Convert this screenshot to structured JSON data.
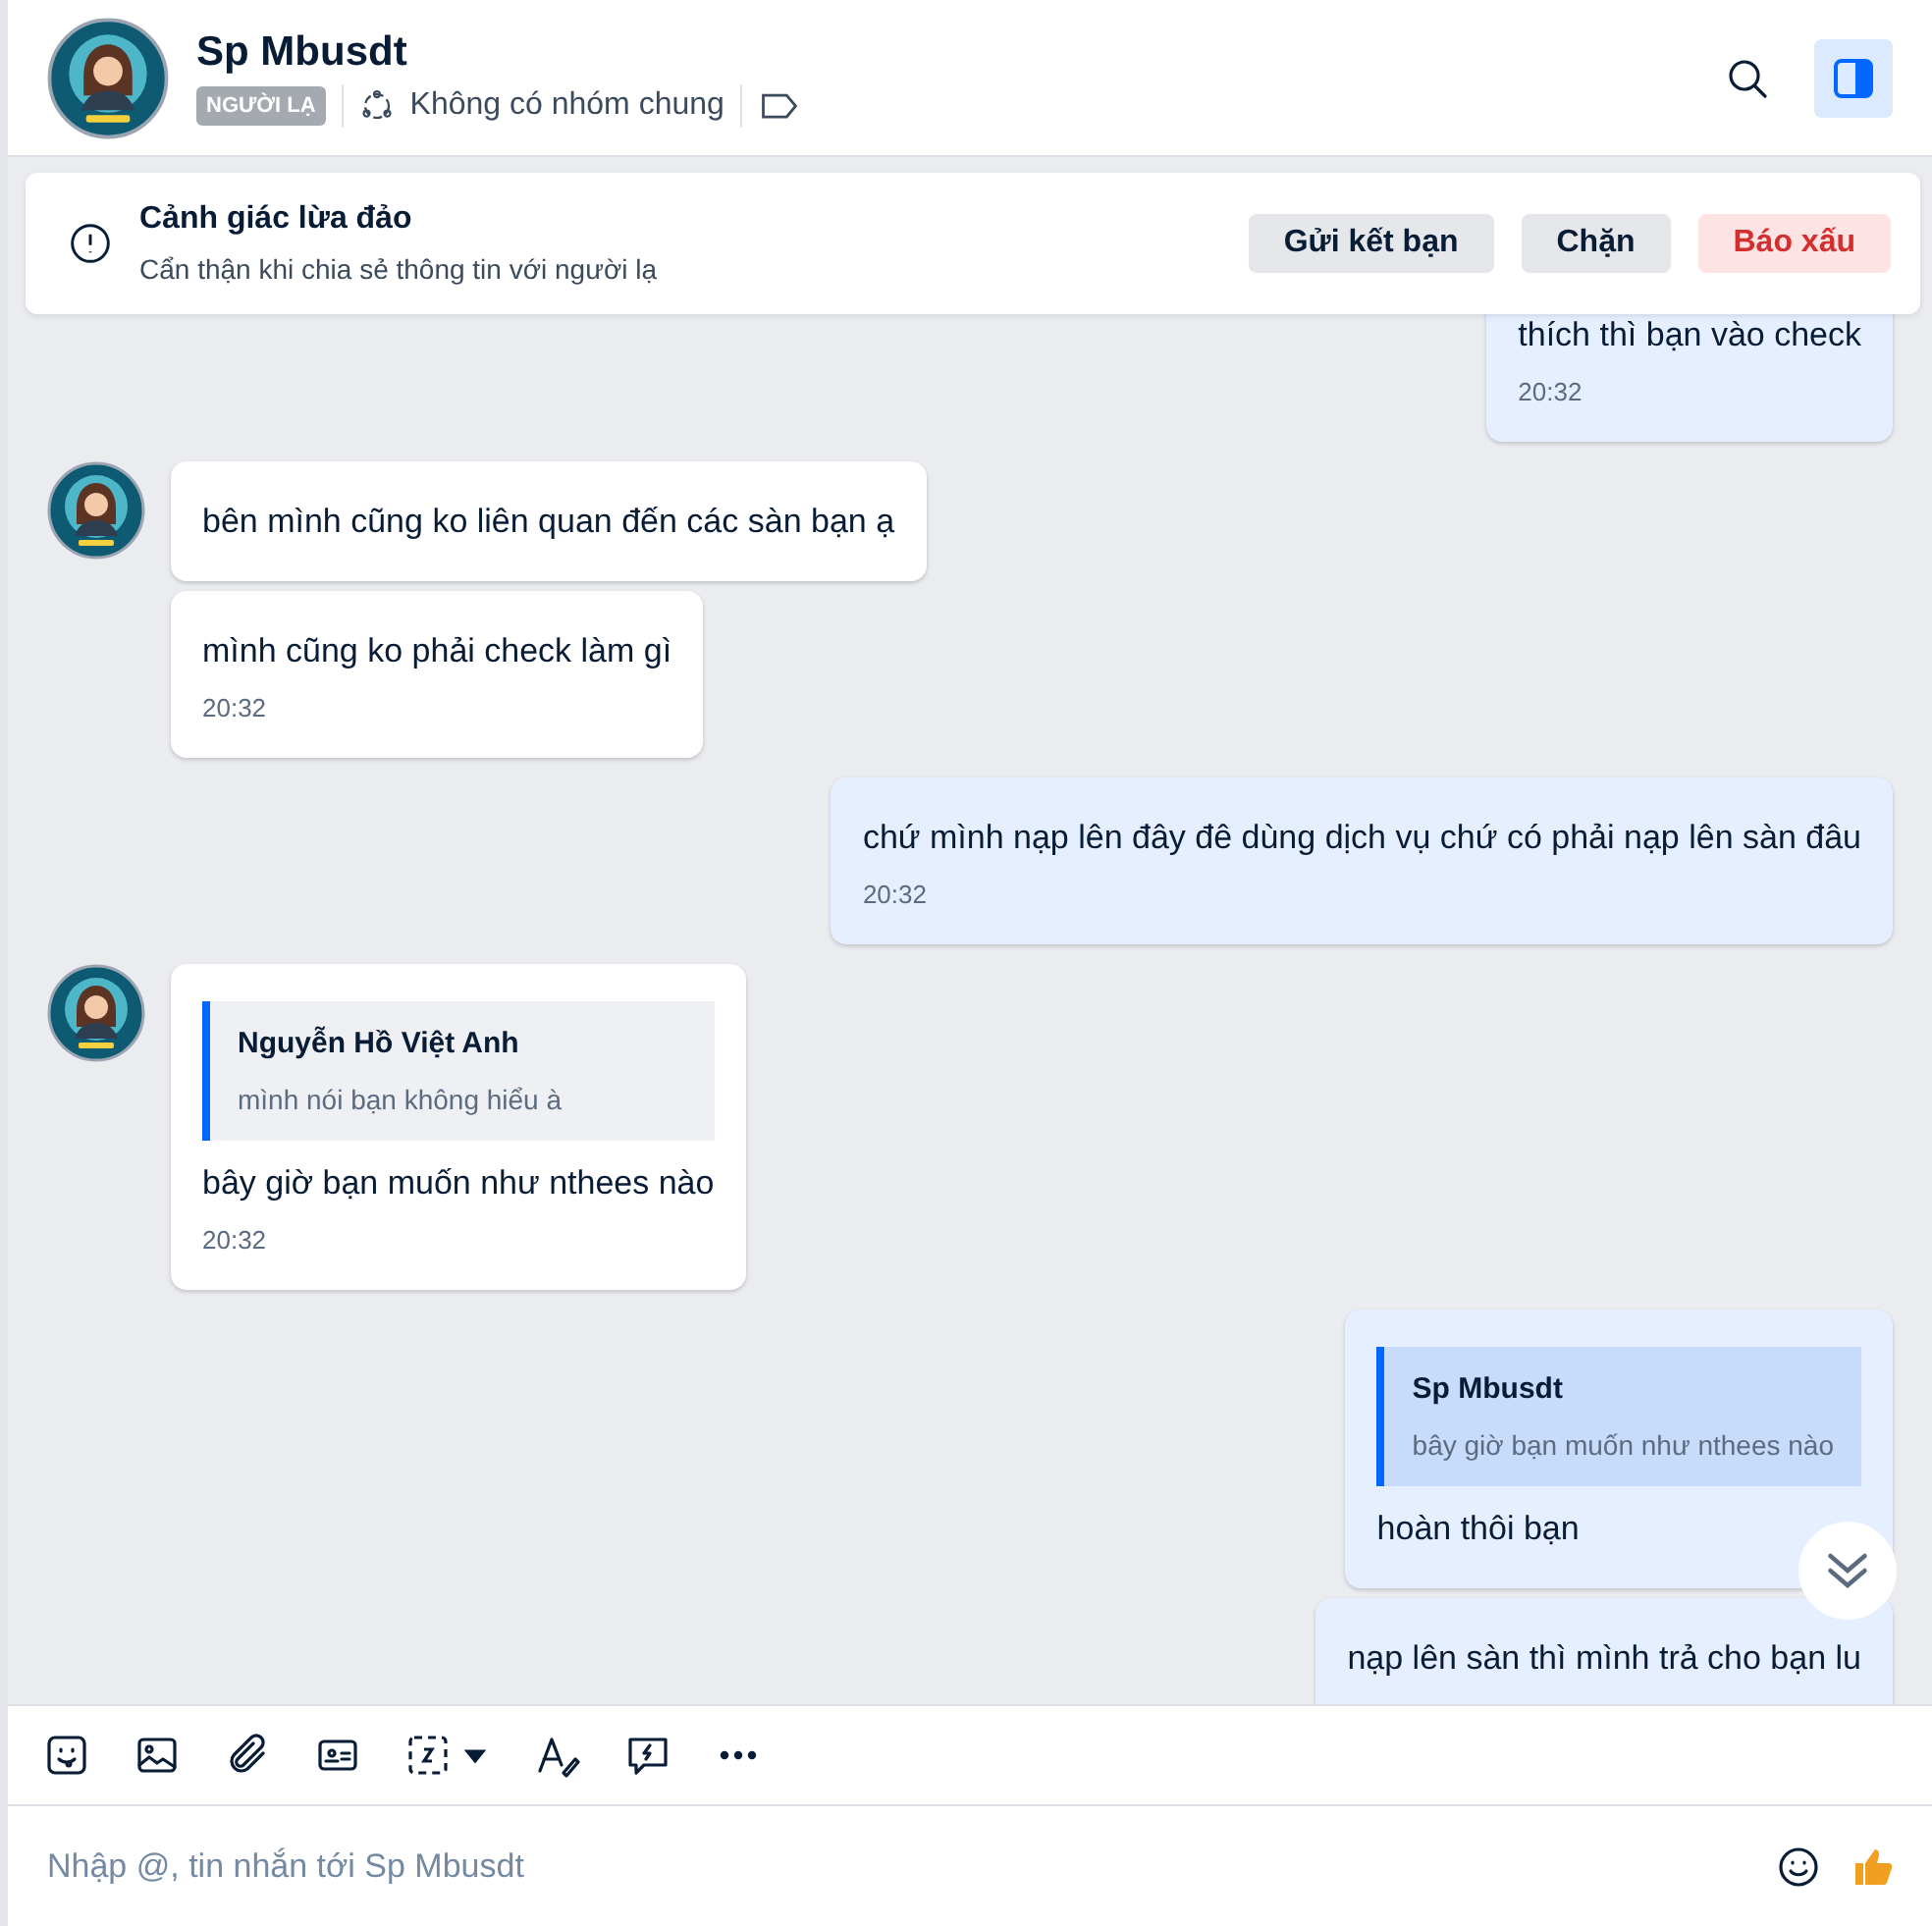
{
  "header": {
    "name": "Sp Mbusdt",
    "tag": "NGƯỜI LẠ",
    "groups": "Không có nhóm chung",
    "panel_open": true
  },
  "alert": {
    "title": "Cảnh giác lừa đảo",
    "text": "Cẩn thận khi chia sẻ thông tin với người lạ",
    "buttons": [
      {
        "label": "Gửi kết bạn",
        "kind": "normal"
      },
      {
        "label": "Chặn",
        "kind": "normal"
      },
      {
        "label": "Báo xấu",
        "kind": "danger"
      }
    ]
  },
  "groups": [
    {
      "kind": "outgoing",
      "messages": [
        {
          "text": "thích thì bạn vào check",
          "time": "20:32"
        }
      ]
    },
    {
      "kind": "incoming",
      "messages": [
        {
          "text": "bên mình cũng ko liên quan đến các sàn bạn ạ"
        },
        {
          "text": "mình cũng ko phải check làm gì",
          "time": "20:32"
        }
      ]
    },
    {
      "kind": "outgoing",
      "messages": [
        {
          "text": "chứ mình nạp lên đây đê dùng dịch vụ chứ có phải nạp lên sàn đâu",
          "time": "20:32"
        }
      ]
    },
    {
      "kind": "incoming",
      "messages": [
        {
          "quote": {
            "name": "Nguyễn Hồ Việt Anh",
            "text": "mình nói bạn không hiểu à"
          },
          "text": "bây giờ bạn muốn như nthees nào",
          "time": "20:32"
        }
      ]
    },
    {
      "kind": "outgoing",
      "messages": [
        {
          "quote": {
            "name": "Sp Mbusdt",
            "text": "bây giờ bạn muốn như nthees nào"
          },
          "text": "hoàn thôi bạn"
        },
        {
          "text": "nạp lên sàn thì mình trả cho bạn lu"
        }
      ]
    }
  ],
  "input": {
    "placeholder": "Nhập @, tin nhắn tới Sp Mbusdt"
  }
}
